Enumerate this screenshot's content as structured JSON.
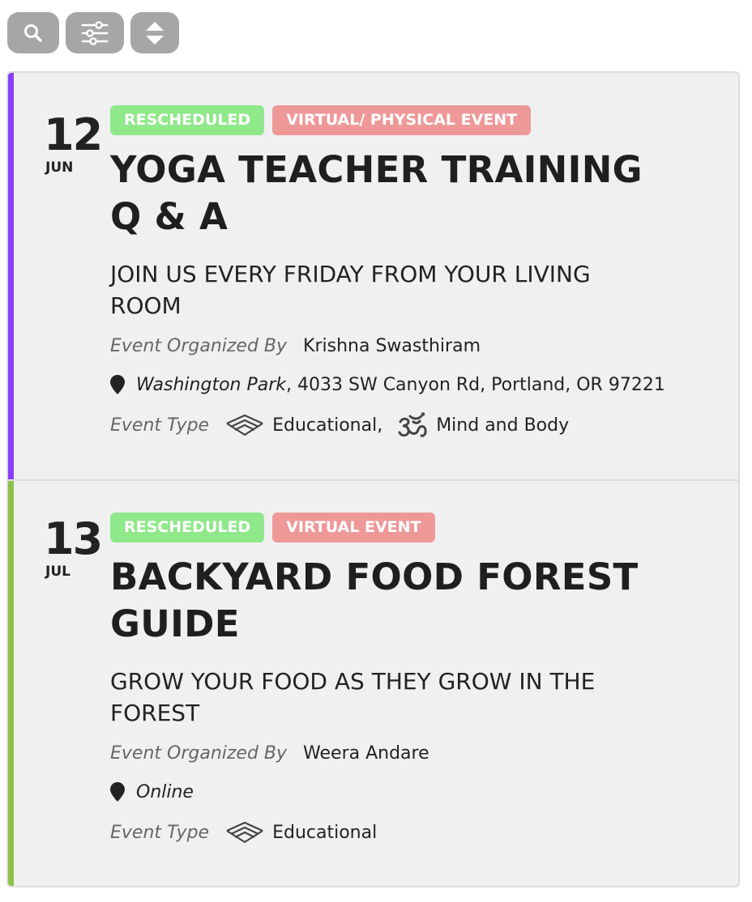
{
  "toolbar": {
    "buttons": [
      {
        "name": "search-button",
        "icon": "search-icon"
      },
      {
        "name": "filter-button",
        "icon": "sliders-icon"
      },
      {
        "name": "sort-button",
        "icon": "sort-icon"
      }
    ]
  },
  "events": [
    {
      "day": "12",
      "month": "JUN",
      "accent_color": "#8a3ffc",
      "badges": [
        {
          "label": "RESCHEDULED",
          "color": "#8fe88a"
        },
        {
          "label": "VIRTUAL/ PHYSICAL EVENT",
          "color": "#ee9898"
        }
      ],
      "title_line1": "YOGA TEACHER TRAINING",
      "title_line2": "Q & A",
      "subtitle_line1": "JOIN US EVERY FRIDAY FROM YOUR LIVING",
      "subtitle_line2": "ROOM",
      "organizer_label": "Event Organized By",
      "organizer": "Krishna Swasthiram",
      "venue_name": "Washington Park",
      "venue_address": ", 4033 SW Canyon Rd, Portland, OR 97221",
      "type_label": "Event Type",
      "types": [
        {
          "label": "Educational,",
          "icon": "wifi-book-icon"
        },
        {
          "label": "Mind and Body",
          "icon": "om-icon"
        }
      ]
    },
    {
      "day": "13",
      "month": "JUL",
      "accent_color": "#8bc34a",
      "badges": [
        {
          "label": "RESCHEDULED",
          "color": "#8fe88a"
        },
        {
          "label": "VIRTUAL EVENT",
          "color": "#ee9898"
        }
      ],
      "title_line1": "BACKYARD FOOD FOREST",
      "title_line2": "GUIDE",
      "subtitle_line1": "GROW YOUR FOOD AS THEY GROW IN THE",
      "subtitle_line2": "FOREST",
      "organizer_label": "Event Organized By",
      "organizer": "Weera Andare",
      "venue_name": "Online",
      "venue_address": "",
      "type_label": "Event Type",
      "types": [
        {
          "label": "Educational",
          "icon": "wifi-book-icon"
        }
      ]
    }
  ]
}
